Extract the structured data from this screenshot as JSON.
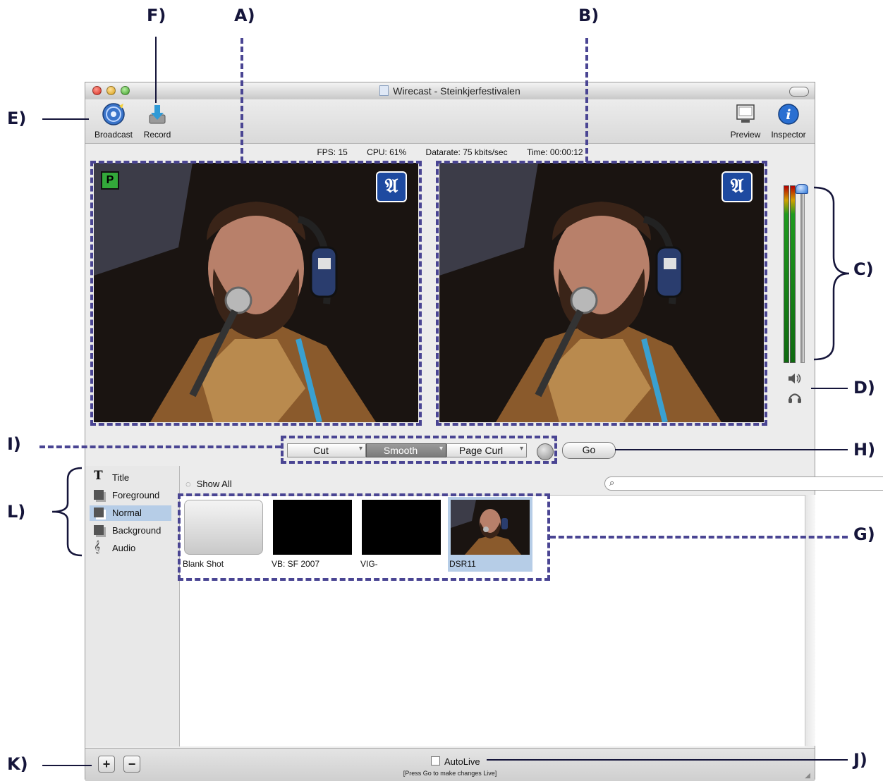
{
  "window": {
    "title": "Wirecast - Steinkjerfestivalen",
    "accent": "#4a4593"
  },
  "toolbar": {
    "broadcast_label": "Broadcast",
    "record_label": "Record",
    "preview_label": "Preview",
    "inspector_label": "Inspector"
  },
  "status": {
    "fps": "FPS: 15",
    "cpu": "CPU: 61%",
    "datarate": "Datarate: 75 kbits/sec",
    "time": "Time: 00:00:12"
  },
  "preview_monitor": {
    "badge": "P",
    "logo": "𝔄"
  },
  "live_monitor": {
    "logo": "𝔄"
  },
  "audio": {
    "volume_level": 1.0,
    "speaker_icon": "speaker-icon",
    "headphones_icon": "headphones-icon"
  },
  "transitions": {
    "items": [
      {
        "label": "Cut"
      },
      {
        "label": "Smooth",
        "selected": true
      },
      {
        "label": "Page Curl"
      }
    ],
    "go_label": "Go"
  },
  "layers": [
    {
      "label": "Title",
      "icon": "title-icon"
    },
    {
      "label": "Foreground",
      "icon": "layer-stack-icon"
    },
    {
      "label": "Normal",
      "icon": "layer-stack-icon",
      "active": true
    },
    {
      "label": "Background",
      "icon": "layer-stack-icon"
    },
    {
      "label": "Audio",
      "icon": "audio-clef-icon"
    }
  ],
  "shots_panel": {
    "filter_label": "Show All",
    "search_placeholder": "",
    "shots": [
      {
        "caption": "Blank Shot"
      },
      {
        "caption": "VB: SF 2007"
      },
      {
        "caption": "VIG-"
      },
      {
        "caption": "DSR11",
        "active": true
      }
    ]
  },
  "bottom": {
    "add_label": "+",
    "remove_label": "−",
    "autolive_label": "AutoLive",
    "hint": "[Press Go to make changes Live]"
  },
  "callouts": {
    "a": "A)",
    "b": "B)",
    "c": "C)",
    "d": "D)",
    "e": "E)",
    "f": "F)",
    "g": "G)",
    "h": "H)",
    "i": "I)",
    "j": "J)",
    "k": "K)",
    "l": "L)"
  }
}
